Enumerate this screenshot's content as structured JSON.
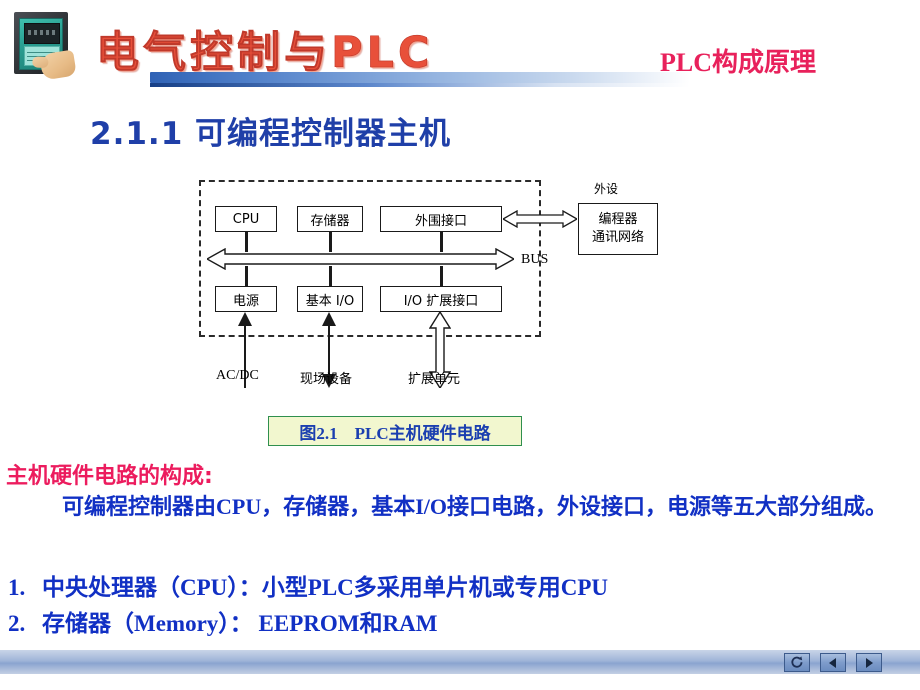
{
  "header": {
    "brand_title": "电气控制与PLC",
    "page_topic": "PLC构成原理",
    "logo_icon": "plc-terminal-with-hand-icon",
    "brand_color": "#e8503a",
    "topic_color": "#e8215b"
  },
  "section": {
    "heading": "2.1.1 可编程控制器主机",
    "heading_color": "#1f3fa8"
  },
  "diagram": {
    "external_label": "外设",
    "bus_label": "BUS",
    "top_row": [
      {
        "id": "cpu",
        "label": "CPU"
      },
      {
        "id": "memory",
        "label": "存储器"
      },
      {
        "id": "peripheral-interface",
        "label": "外围接口"
      }
    ],
    "bottom_row": [
      {
        "id": "power-supply",
        "label": "电源"
      },
      {
        "id": "basic-io",
        "label": "基本 I/O"
      },
      {
        "id": "io-expansion-interface",
        "label": "I/O 扩展接口"
      }
    ],
    "external_box": {
      "line1": "编程器",
      "line2": "通讯网络"
    },
    "bottom_labels": [
      {
        "id": "acdc",
        "label": "AC/DC"
      },
      {
        "id": "field-device",
        "label": "现场设备"
      },
      {
        "id": "expansion-unit",
        "label": "扩展单元"
      }
    ],
    "caption": "图2.1　PLC主机硬件电路",
    "caption_color": "#1b3fb0",
    "caption_bg": "#f2f7cf",
    "caption_border": "#2f8f4e"
  },
  "content": {
    "heading": "主机硬件电路的构成:",
    "heading_color": "#ec1c5e",
    "paragraph": "可编程控制器由CPU，存储器，基本I/O接口电路，外设接口，电源等五大部分组成。",
    "text_color": "#1130c4",
    "list": [
      {
        "num": "1.",
        "text": "中央处理器（CPU）：小型PLC多采用单片机或专用CPU"
      },
      {
        "num": "2.",
        "text": "存储器（Memory）：  EEPROM和RAM"
      }
    ]
  },
  "navigation": {
    "loop_icon": "loop-arrow-icon",
    "prev_icon": "triangle-left-icon",
    "next_icon": "triangle-right-icon"
  }
}
